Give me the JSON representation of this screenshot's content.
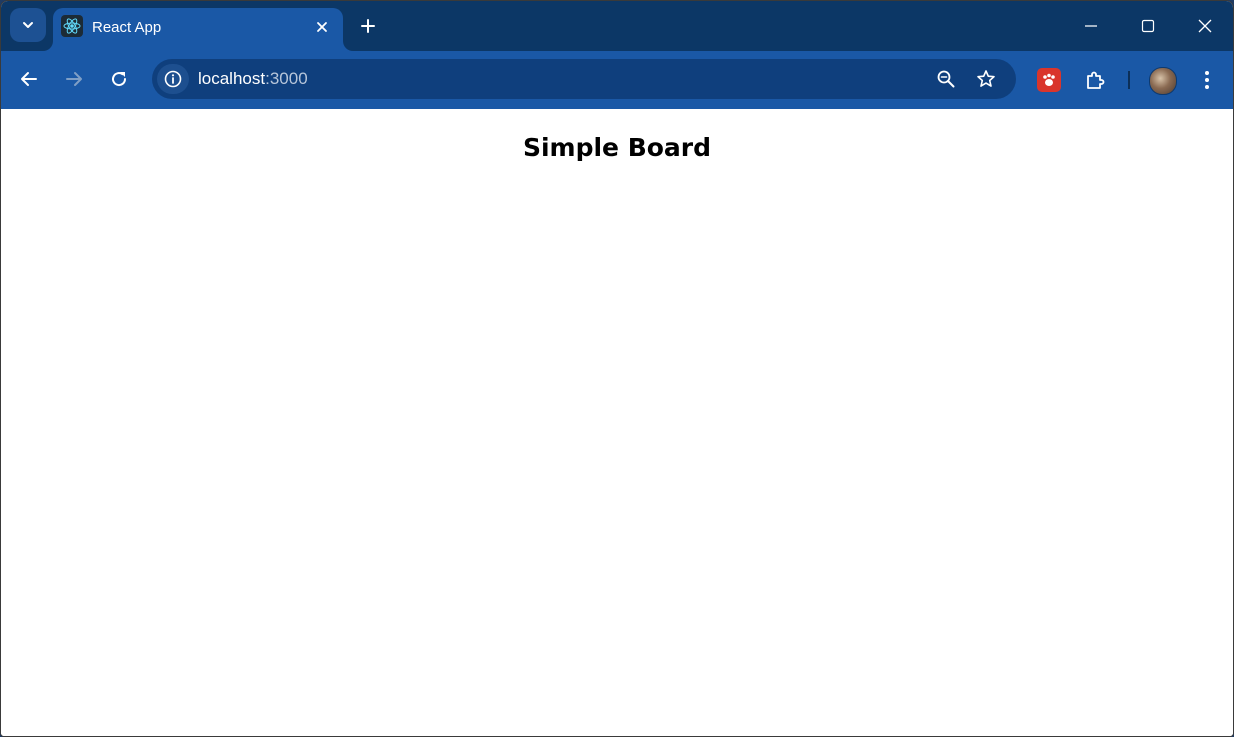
{
  "browser": {
    "tab": {
      "title": "React App",
      "favicon": "react-logo-icon"
    },
    "address_bar": {
      "host": "localhost",
      "port": ":3000"
    },
    "colors": {
      "tabstrip": "#0c3766",
      "toolbar": "#1a58a6",
      "omnibox": "#0f3f7d"
    }
  },
  "page": {
    "title": "Simple Board"
  }
}
